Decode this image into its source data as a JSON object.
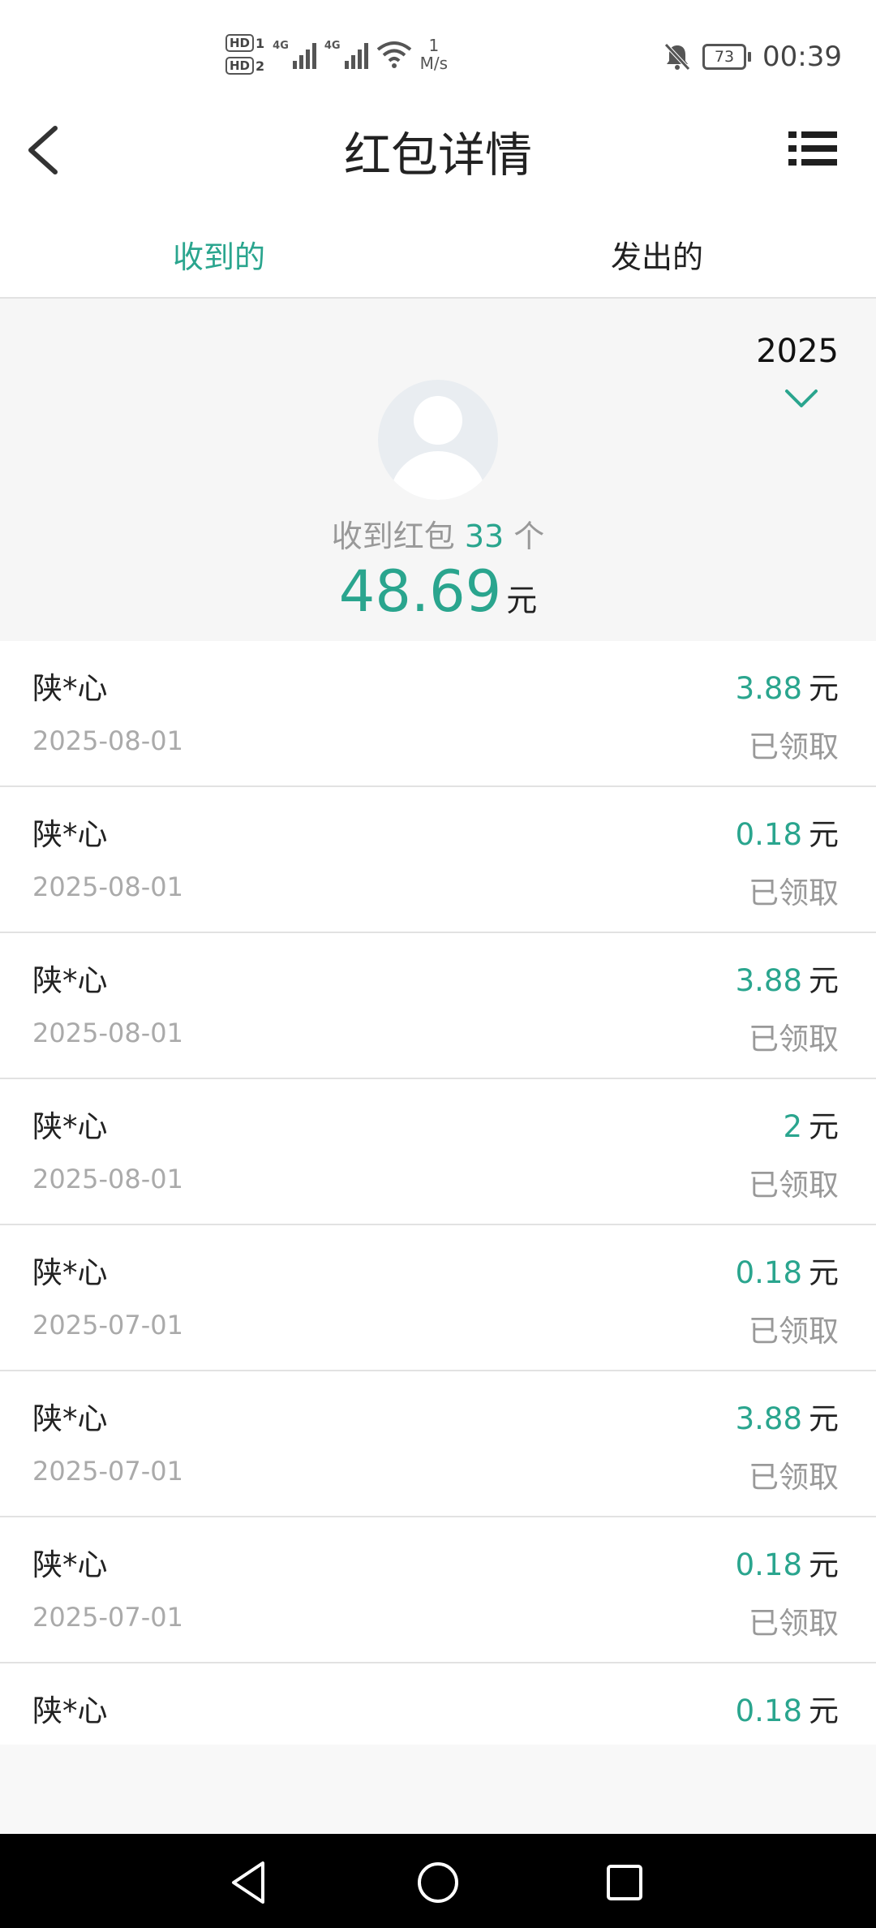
{
  "status_bar": {
    "hd1": "HD",
    "hd1_sub": "1",
    "hd2": "HD",
    "hd2_sub": "2",
    "net1": "4G",
    "net2": "4G",
    "speed_value": "1",
    "speed_unit": "M/s",
    "battery": "73",
    "time": "00:39"
  },
  "header": {
    "title": "红包详情"
  },
  "tabs": [
    {
      "label": "收到的",
      "active": true
    },
    {
      "label": "发出的",
      "active": false
    }
  ],
  "summary": {
    "year": "2025",
    "count_prefix": "收到红包",
    "count": "33",
    "count_suffix": "个",
    "total": "48.69",
    "unit": "元"
  },
  "records": [
    {
      "name": "陕*心",
      "date": "2025-08-01",
      "amount": "3.88",
      "unit": "元",
      "status": "已领取"
    },
    {
      "name": "陕*心",
      "date": "2025-08-01",
      "amount": "0.18",
      "unit": "元",
      "status": "已领取"
    },
    {
      "name": "陕*心",
      "date": "2025-08-01",
      "amount": "3.88",
      "unit": "元",
      "status": "已领取"
    },
    {
      "name": "陕*心",
      "date": "2025-08-01",
      "amount": "2",
      "unit": "元",
      "status": "已领取"
    },
    {
      "name": "陕*心",
      "date": "2025-07-01",
      "amount": "0.18",
      "unit": "元",
      "status": "已领取"
    },
    {
      "name": "陕*心",
      "date": "2025-07-01",
      "amount": "3.88",
      "unit": "元",
      "status": "已领取"
    },
    {
      "name": "陕*心",
      "date": "2025-07-01",
      "amount": "0.18",
      "unit": "元",
      "status": "已领取"
    },
    {
      "name": "陕*心",
      "amount": "0.18",
      "unit": "元"
    }
  ],
  "colors": {
    "accent": "#2aa58e",
    "summary_bg": "#f6f6f6",
    "navbar_bg": "#000000"
  }
}
